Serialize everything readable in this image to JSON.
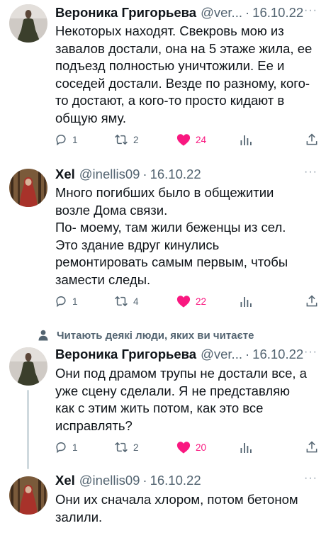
{
  "tweets": [
    {
      "name": "Вероника Григорьева",
      "handle": "@ver...",
      "separator": "·",
      "date": "16.10.22",
      "text": "Некоторых находят. Свекровь мою из\nзавалов достали, она на 5 этаже жила, ее\nподъезд полностью уничтожили. Ее и\nсоседей достали. Везде по разному, кого-\nто достают, а кого-то просто кидают в\nобщую яму.",
      "replies": "1",
      "retweets": "2",
      "likes": "24"
    },
    {
      "name": "Xel",
      "handle": "@inellis09",
      "separator": "·",
      "date": "16.10.22",
      "text": "Много погибших было в общежитии\nвозле Дома связи.\nПо- моему, там жили беженцы из сел.\nЭто здание вдруг кинулись\nремонтировать самым первым, чтобы\nзамести следы.",
      "replies": "1",
      "retweets": "4",
      "likes": "22"
    },
    {
      "name": "Вероника Григорьева",
      "handle": "@ver...",
      "separator": "·",
      "date": "16.10.22",
      "text": "Они под драмом трупы не достали все, а\nуже сцену сделали. Я не представляю\nкак с этим жить потом, как это все\nисправлять?",
      "replies": "1",
      "retweets": "2",
      "likes": "20"
    },
    {
      "name": "Xel",
      "handle": "@inellis09",
      "separator": "·",
      "date": "16.10.22",
      "text": "Они их сначала хлором, потом бетоном\nзалили."
    }
  ],
  "context_label": "Читають деякі люди, яких ви читаєте",
  "more_glyph": "···",
  "colors": {
    "like": "#f91880",
    "secondary": "#536471",
    "line": "#cfd9de"
  },
  "icons": [
    "reply-icon",
    "retweet-icon",
    "heart-icon",
    "views-icon",
    "share-icon",
    "person-icon",
    "more-icon"
  ]
}
